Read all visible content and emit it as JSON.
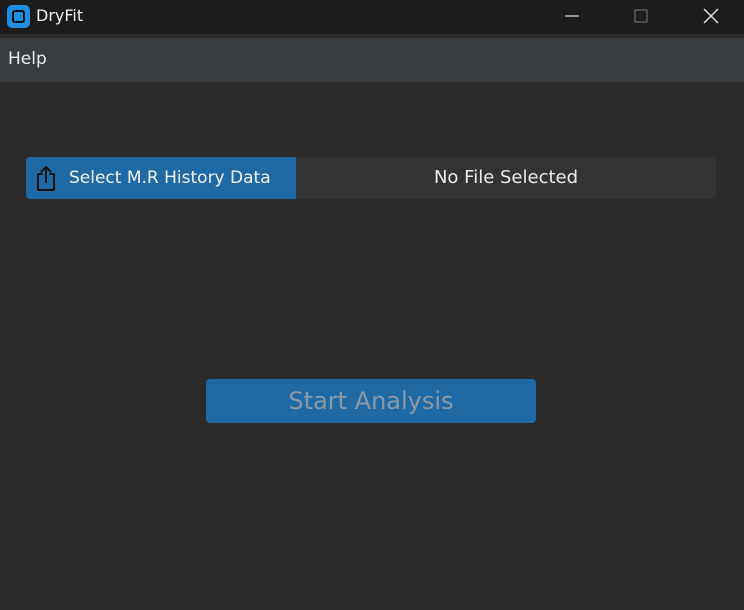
{
  "window": {
    "title": "DryFit",
    "app_icon": "app-icon",
    "controls": [
      "minimize-icon",
      "maximize-icon",
      "close-icon"
    ]
  },
  "menu": {
    "items": [
      {
        "label": "Help"
      }
    ]
  },
  "file_select": {
    "button_label": "Select M.R History Data",
    "button_icon": "upload-icon",
    "status": "No File Selected"
  },
  "actions": {
    "start_label": "Start Analysis"
  },
  "colors": {
    "background": "#2b2b2b",
    "titlebar": "#1c1c1c",
    "menubar": "#3a3d40",
    "accent": "#1f6aa5",
    "app_icon": "#1f8fe3"
  }
}
